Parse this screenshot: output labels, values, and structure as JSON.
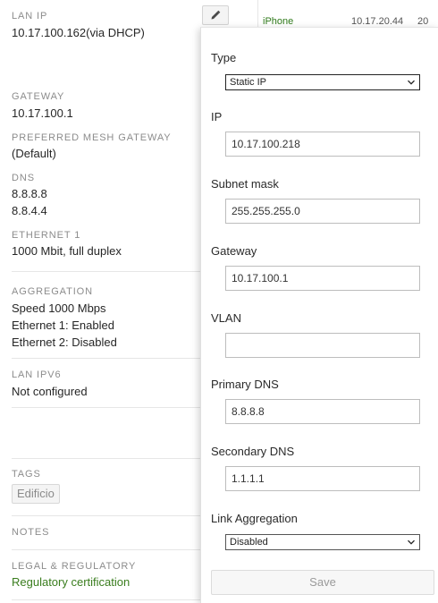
{
  "left": {
    "lan_ip": {
      "label": "LAN IP",
      "value": "10.17.100.162",
      "suffix": "(via DHCP)"
    },
    "gateway": {
      "label": "GATEWAY",
      "value": "10.17.100.1"
    },
    "preferred_mesh_gateway": {
      "label": "PREFERRED MESH GATEWAY",
      "value": "(Default)"
    },
    "dns": {
      "label": "DNS",
      "values": [
        "8.8.8.8",
        "8.8.4.4"
      ]
    },
    "ethernet1": {
      "label": "ETHERNET 1",
      "value": "1000 Mbit, full duplex"
    },
    "aggregation": {
      "label": "AGGREGATION",
      "lines": [
        "Speed 1000 Mbps",
        "Ethernet 1: Enabled",
        "Ethernet 2: Disabled"
      ]
    },
    "lan_ipv6": {
      "label": "LAN IPV6",
      "value": "Not configured"
    },
    "tags": {
      "label": "TAGS",
      "items": [
        "Edificio"
      ]
    },
    "notes": {
      "label": "NOTES"
    },
    "legal": {
      "label": "LEGAL & REGULATORY",
      "link": "Regulatory certification"
    }
  },
  "background_row": {
    "name": "iPhone",
    "ip": "10.17.20.44",
    "num": "20"
  },
  "panel": {
    "type": {
      "label": "Type",
      "selected": "Static IP"
    },
    "ip": {
      "label": "IP",
      "value": "10.17.100.218"
    },
    "subnet": {
      "label": "Subnet mask",
      "value": "255.255.255.0"
    },
    "gateway": {
      "label": "Gateway",
      "value": "10.17.100.1"
    },
    "vlan": {
      "label": "VLAN",
      "value": ""
    },
    "primary_dns": {
      "label": "Primary DNS",
      "value": "8.8.8.8"
    },
    "secondary_dns": {
      "label": "Secondary DNS",
      "value": "1.1.1.1"
    },
    "link_aggregation": {
      "label": "Link Aggregation",
      "selected": "Disabled"
    },
    "save_label": "Save"
  },
  "icons": {
    "edit": "pencil-icon",
    "dropdown": "chevron-down-icon"
  },
  "colors": {
    "link": "#3a7d1e",
    "label": "#8c8c8c"
  }
}
